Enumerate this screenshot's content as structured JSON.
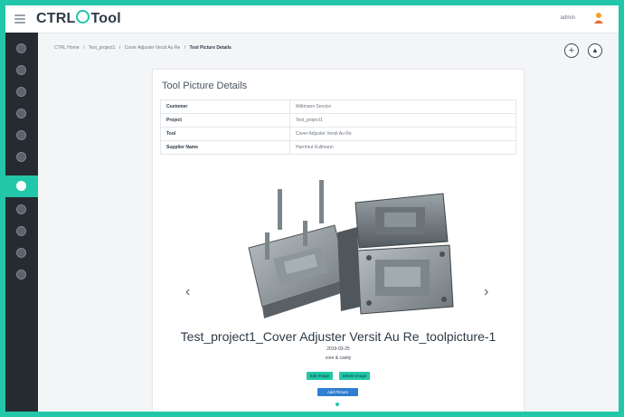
{
  "app": {
    "brand_prefix": "CTRL",
    "brand_suffix": "Tool",
    "user_name": "admin"
  },
  "breadcrumb": [
    "CTRL Home",
    "/",
    "Test_project1",
    "/",
    "Cover Adjuster Versit Au Re",
    "/",
    "Tool Picture Details"
  ],
  "actions": {
    "add_symbol": "+",
    "upload_symbol": "▲"
  },
  "card": {
    "title": "Tool Picture Details",
    "rows": [
      {
        "key": "Customer",
        "value": "Wittmann Service"
      },
      {
        "key": "Project",
        "value": "Test_project1"
      },
      {
        "key": "Tool",
        "value": "Cover Adjuster Versit Au Re"
      },
      {
        "key": "Supplier Name",
        "value": "Harrtmut Kullmann"
      }
    ]
  },
  "carousel": {
    "prev_symbol": "‹",
    "next_symbol": "›",
    "picture_title": "Test_project1_Cover Adjuster Versit Au Re_toolpicture-1",
    "date": "2019-03-25",
    "description": "core & cavity",
    "edit_label": "Edit Image",
    "delete_label": "Delete Image",
    "add_label": "Add Picture"
  },
  "colors": {
    "accent": "#22c7a9",
    "sidebar": "#262b31",
    "primary_button": "#2f7fd1"
  },
  "sidebar_icons": [
    "dashboard-icon",
    "customers-icon",
    "projects-icon",
    "tools-icon",
    "machines-icon",
    "history-icon",
    "pictures-icon",
    "documents-icon",
    "settings-icon",
    "users-icon",
    "help-icon"
  ]
}
